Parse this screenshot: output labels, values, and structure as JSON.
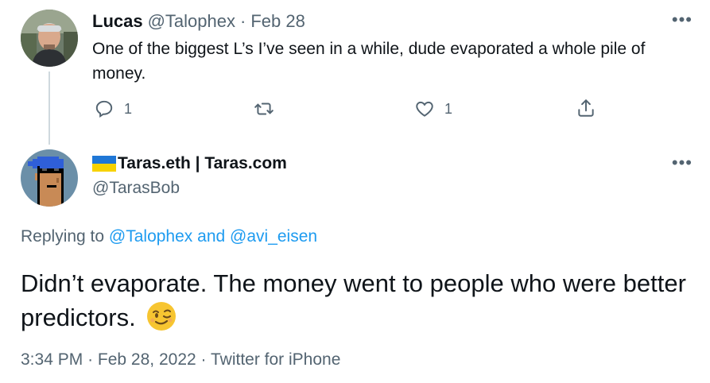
{
  "reply_tweet": {
    "name": "Lucas",
    "handle": "@Talophex",
    "separator": "·",
    "date": "Feb 28",
    "text": "One of the biggest L’s I’ve seen in a while, dude evaporated a whole pile of money.",
    "more_icon": "more-dots-icon",
    "actions": {
      "reply_count": "1",
      "like_count": "1"
    }
  },
  "main_tweet": {
    "name": "Taras.eth | Taras.com",
    "handle": "@TarasBob",
    "replying": {
      "prefix": "Replying to",
      "user1": "@Talophex",
      "conjunction": "and",
      "user2": "@avi_eisen"
    },
    "text": "Didn’t evaporate. The money went to people who were better predictors.",
    "emoji": "winking-face",
    "meta": {
      "time": "3:34 PM",
      "separator": "·",
      "date": "Feb 28, 2022",
      "source": "Twitter for iPhone"
    }
  },
  "colors": {
    "text": "#0f1419",
    "muted": "#536471",
    "link": "#1d9bf0",
    "thread_line": "#cfd9de",
    "flag_blue": "#1f77d6",
    "flag_yellow": "#f7d200"
  }
}
